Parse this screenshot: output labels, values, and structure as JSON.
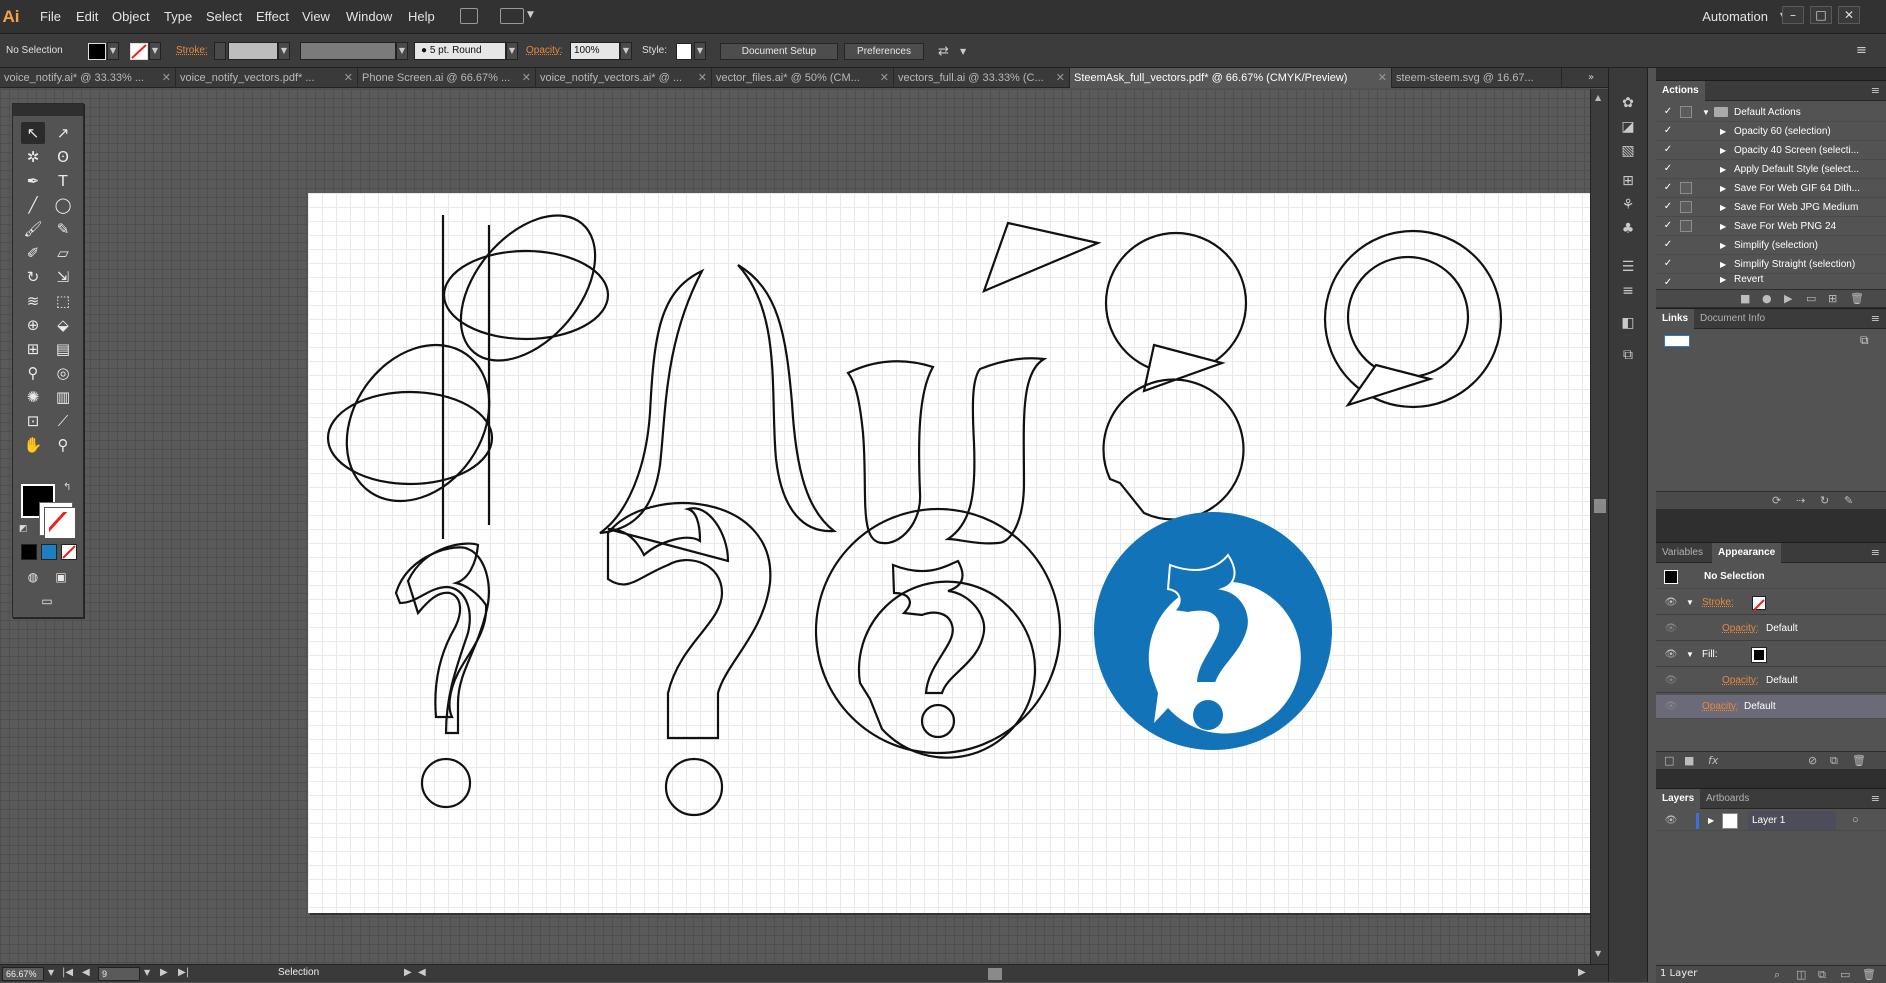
{
  "app": {
    "logo": "Ai",
    "workspace": "Automation"
  },
  "menu": [
    "File",
    "Edit",
    "Object",
    "Type",
    "Select",
    "Effect",
    "View",
    "Window",
    "Help"
  ],
  "control_bar": {
    "selection_label": "No Selection",
    "stroke_label": "Stroke:",
    "brush_value": "5 pt. Round",
    "opacity_label": "Opacity:",
    "opacity_value": "100%",
    "style_label": "Style:",
    "document_setup": "Document Setup",
    "preferences": "Preferences"
  },
  "tabs": [
    "voice_notify.ai* @ 33.33% ...",
    "voice_notify_vectors.pdf* ...",
    "Phone Screen.ai @ 66.67% ...",
    "voice_notify_vectors.ai* @ ...",
    "vector_files.ai* @ 50% (CM...",
    "vectors_full.ai @ 33.33% (C...",
    "SteemAsk_full_vectors.pdf* @ 66.67% (CMYK/Preview)",
    "steem-steem.svg @ 16.67..."
  ],
  "active_tab_index": 6,
  "actions_panel": {
    "tab": "Actions",
    "set": "Default Actions",
    "items": [
      "Opacity 60 (selection)",
      "Opacity 40 Screen (selecti...",
      "Apply Default Style (select...",
      "Save For Web GIF 64 Dith...",
      "Save For Web JPG Medium",
      "Save For Web PNG 24",
      "Simplify (selection)",
      "Simplify Straight (selection)",
      "Revert"
    ]
  },
  "links_panel": {
    "tabs": [
      "Links",
      "Document Info"
    ]
  },
  "appearance_panel": {
    "tabs": [
      "Variables",
      "Appearance"
    ],
    "title": "No Selection",
    "stroke_label": "Stroke:",
    "fill_label": "Fill:",
    "opacity_label": "Opacity:",
    "opacity_value": "Default"
  },
  "layers_panel": {
    "tabs": [
      "Layers",
      "Artboards"
    ],
    "layer_name": "Layer 1",
    "footer": "1 Layer"
  },
  "status_bar": {
    "zoom": "66.67%",
    "page": "9",
    "tool": "Selection"
  },
  "colors": {
    "logo_blue": "#1273b9",
    "accent_orange": "#e8893e",
    "app_orange": "#f7a23c"
  }
}
